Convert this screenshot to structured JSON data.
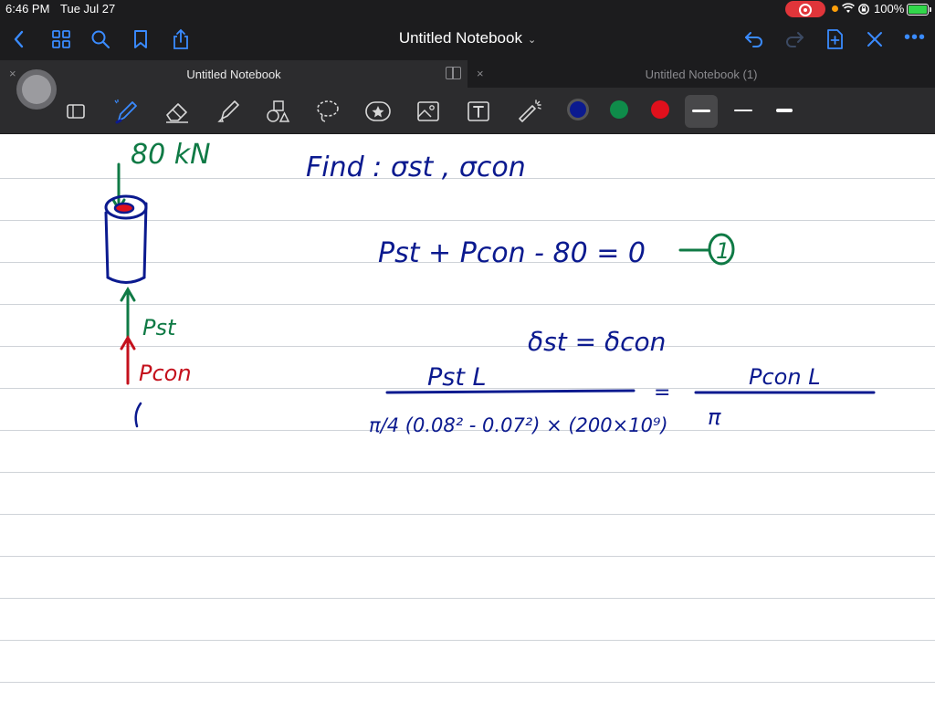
{
  "status": {
    "time": "6:46 PM",
    "date": "Tue Jul 27",
    "battery": "100%"
  },
  "nav": {
    "title": "Untitled Notebook",
    "title_chevron": "⌄",
    "more": "•••"
  },
  "tabs": [
    {
      "label": "Untitled Notebook",
      "close": "×"
    },
    {
      "label": "Untitled Notebook (1)",
      "close": "×"
    }
  ],
  "toolbar": {
    "tools": [
      "image-icon",
      "pen-icon",
      "eraser-icon",
      "highlighter-icon",
      "shapes-icon",
      "lasso-icon",
      "sticker-icon",
      "photo-icon",
      "text-icon",
      "laser-pointer-icon"
    ],
    "colors": [
      "#0b1a8f",
      "#0f8c4a",
      "#e0101c"
    ],
    "selected_color": "#0b1a8f",
    "stroke_widths": [
      "thin",
      "medium",
      "thick"
    ],
    "selected_stroke": "thin"
  },
  "handwriting": {
    "force_label": "80 kN",
    "find_line": "Find :  σst , σcon",
    "equation_1": "Pst + Pcon - 80 = 0",
    "equation_1_tag": "1",
    "compat": "δst = δcon",
    "frac_left_num": "Pst L",
    "frac_left_den": "π/4 (0.08² - 0.07²) × (200×10⁹)",
    "equals": "=",
    "frac_right_num": "Pcon L",
    "frac_right_den": "π",
    "reaction_steel": "Pst",
    "reaction_concrete": "Pcon",
    "stray_mark": "("
  }
}
